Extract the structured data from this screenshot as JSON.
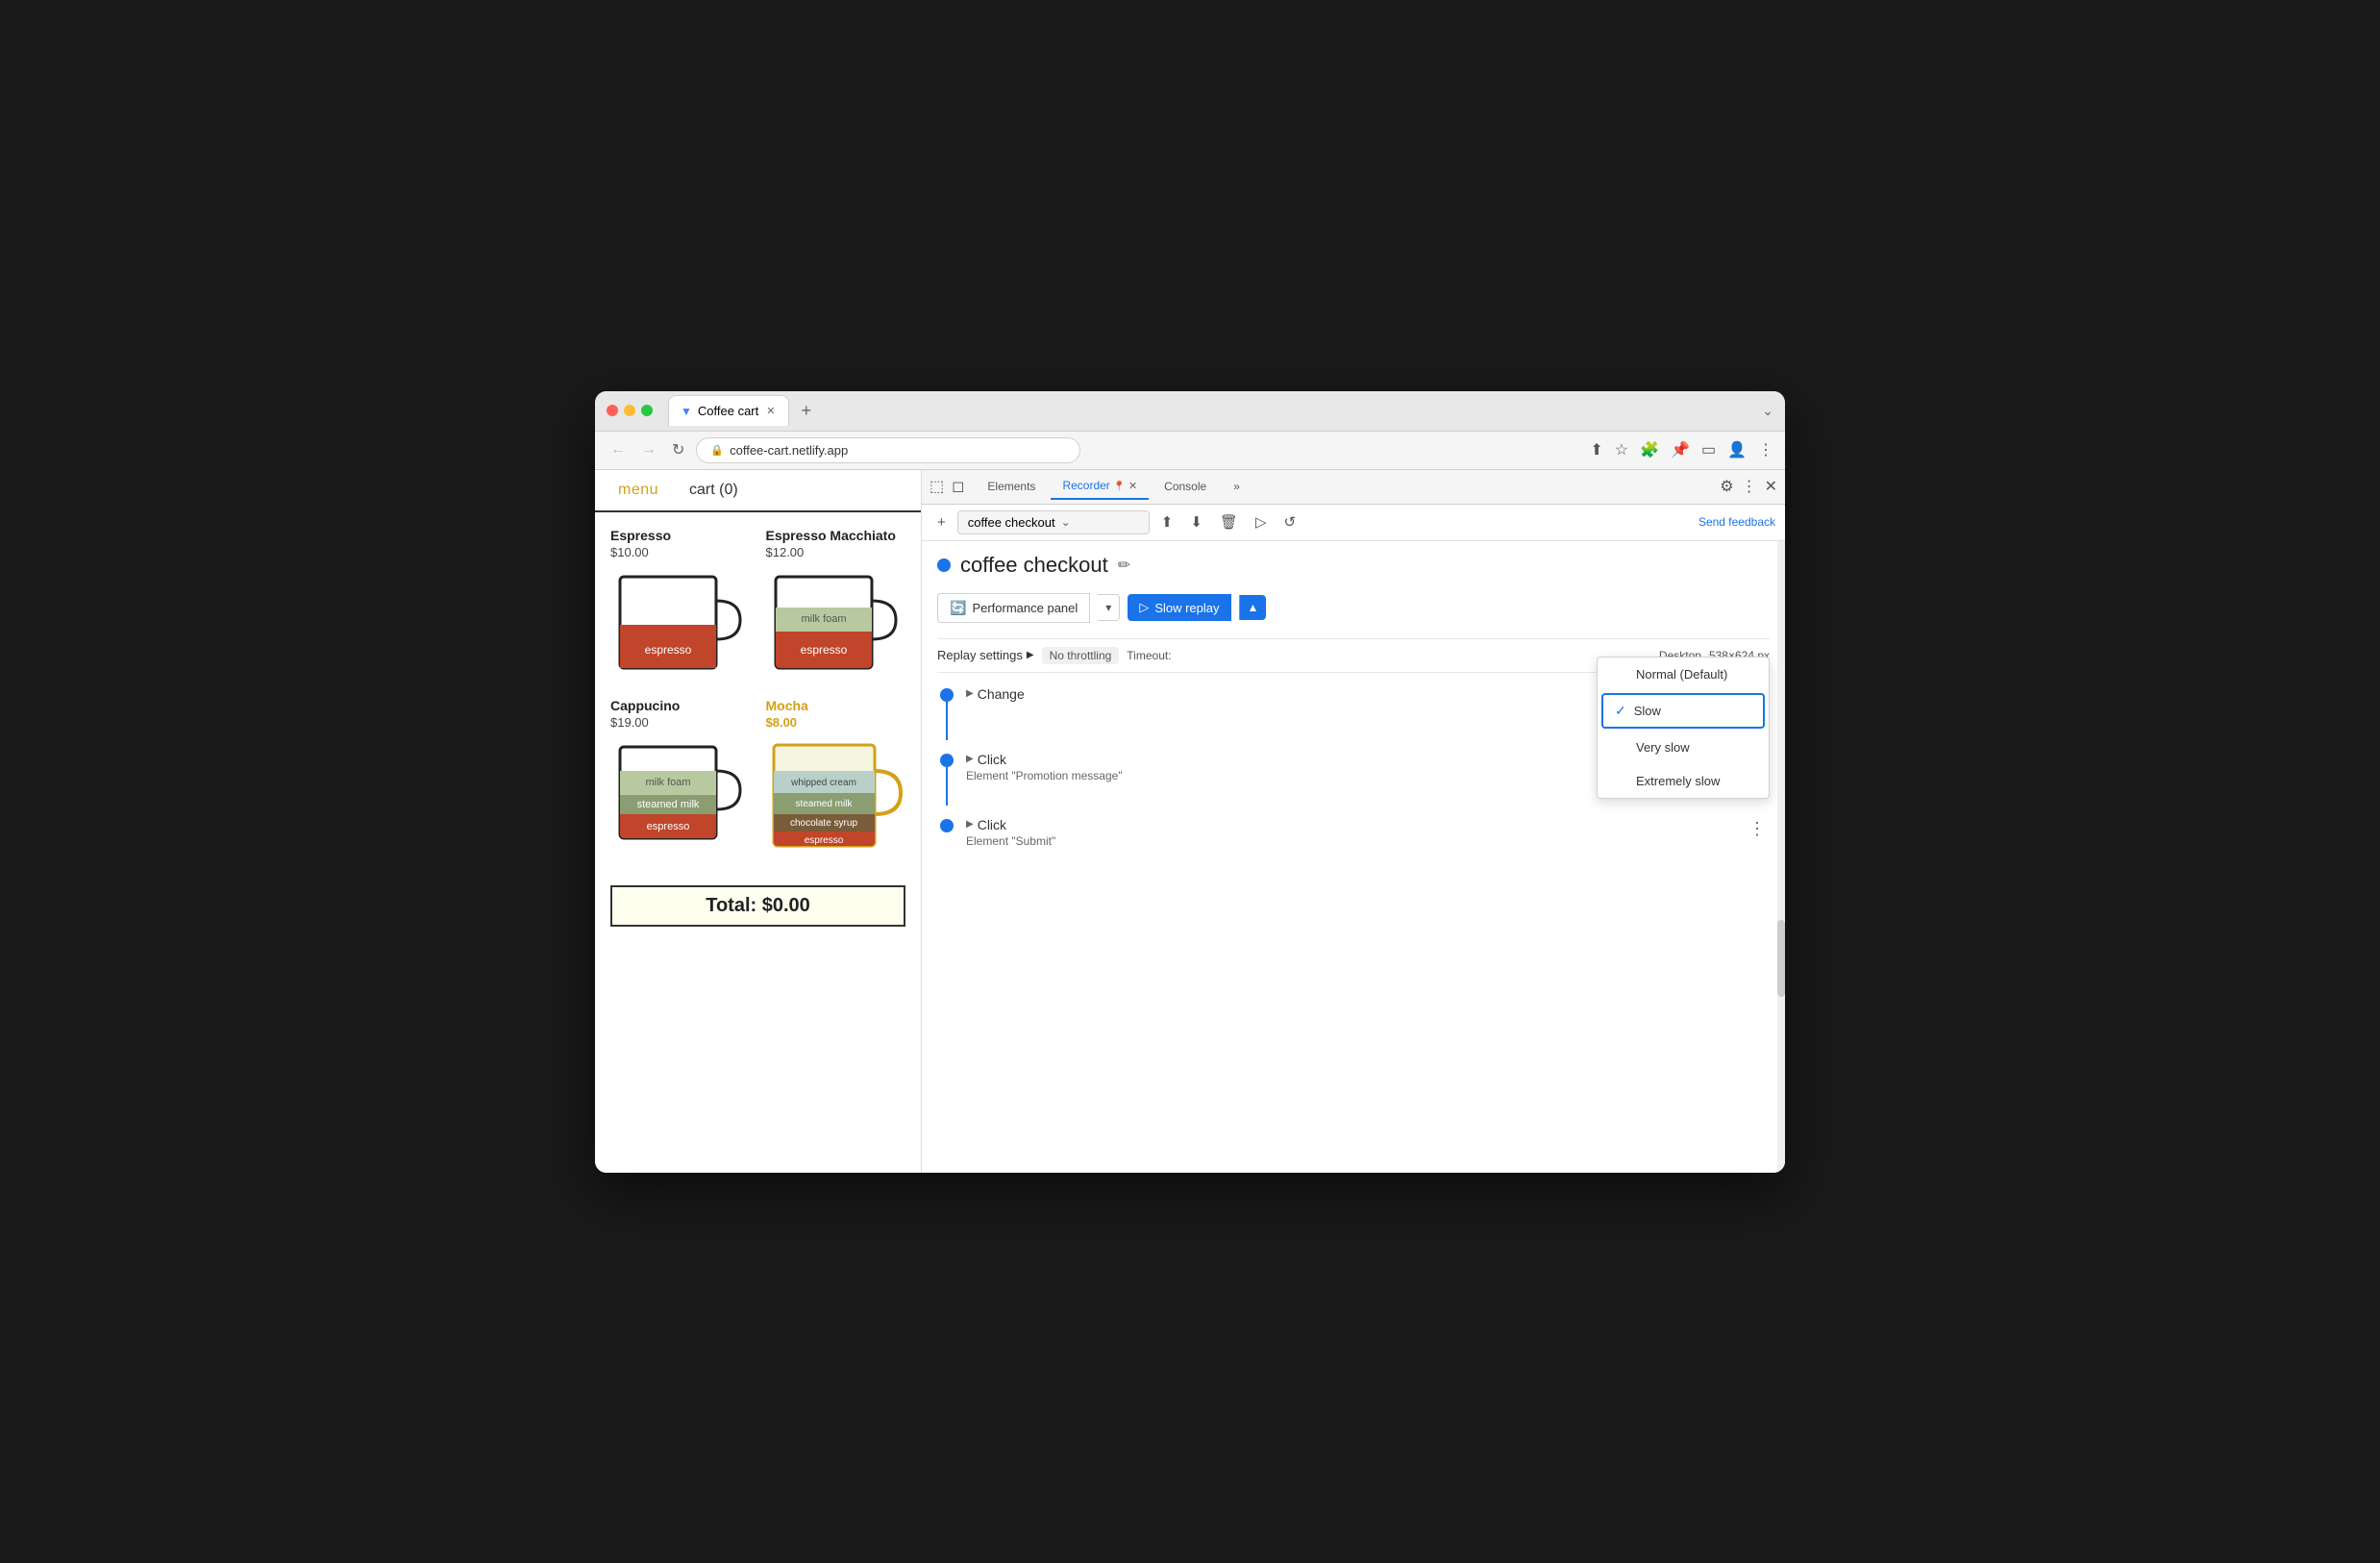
{
  "browser": {
    "title": "Coffee cart",
    "url": "coffee-cart.netlify.app",
    "tab_label": "Coffee cart",
    "new_tab_label": "+",
    "chevron_down": "⌄"
  },
  "coffee_site": {
    "nav": {
      "menu": "menu",
      "cart": "cart (0)"
    },
    "items": [
      {
        "name": "Espresso",
        "price": "$10.00",
        "highlight": false,
        "layers": [
          {
            "label": "espresso",
            "color": "#c0452a",
            "height": 40
          }
        ]
      },
      {
        "name": "Espresso Macchiato",
        "price": "$12.00",
        "highlight": false,
        "layers": [
          {
            "label": "milk foam",
            "color": "#b8c9a0",
            "height": 20
          },
          {
            "label": "espresso",
            "color": "#c0452a",
            "height": 40
          }
        ]
      },
      {
        "name": "Cappucino",
        "price": "$19.00",
        "highlight": false,
        "layers": [
          {
            "label": "milk foam",
            "color": "#b8c9a0",
            "height": 25
          },
          {
            "label": "steamed milk",
            "color": "#8a9e72",
            "height": 25
          },
          {
            "label": "espresso",
            "color": "#c0452a",
            "height": 35
          }
        ]
      },
      {
        "name": "Mocha",
        "price": "$8.00",
        "highlight": true,
        "layers": [
          {
            "label": "whipped cream",
            "color": "#b8d0c8",
            "height": 22
          },
          {
            "label": "steamed milk",
            "color": "#8a9e72",
            "height": 22
          },
          {
            "label": "chocolate syrup",
            "color": "#7a5c3a",
            "height": 22
          },
          {
            "label": "espresso",
            "color": "#c0452a",
            "height": 22
          }
        ]
      }
    ],
    "total": "Total: $0.00"
  },
  "devtools": {
    "tabs": [
      "Elements",
      "Recorder",
      "Console"
    ],
    "active_tab": "Recorder",
    "more_tabs": "»",
    "close": "✕",
    "settings_icon": "⚙",
    "more_icon": "⋮",
    "toolbar": {
      "add_icon": "+",
      "upload_icon": "⬆",
      "download_icon": "⬇",
      "delete_icon": "🗑",
      "play_icon": "▷",
      "history_icon": "↺",
      "send_feedback": "Send feedback",
      "recording_name": "coffee checkout",
      "dropdown_arrow": "⌄"
    },
    "recording": {
      "title": "coffee checkout",
      "edit_icon": "✏",
      "perf_panel": "Performance panel",
      "slow_replay": "Slow replay",
      "play_icon": "▷",
      "dropdown_arrow": "▲",
      "perf_dropdown": "▾"
    },
    "speed_dropdown": {
      "options": [
        {
          "label": "Normal (Default)",
          "selected": false
        },
        {
          "label": "Slow",
          "selected": true
        },
        {
          "label": "Very slow",
          "selected": false
        },
        {
          "label": "Extremely slow",
          "selected": false
        }
      ]
    },
    "replay_settings": {
      "label": "Replay settings",
      "arrow": "▶",
      "throttle": "No throttling",
      "timeout_label": "Timeout:",
      "env": "Desktop",
      "size": "538×624 px"
    },
    "steps": [
      {
        "title": "Change",
        "desc": "",
        "has_connector": true
      },
      {
        "title": "Click",
        "desc": "Element \"Promotion message\"",
        "has_connector": true
      },
      {
        "title": "Click",
        "desc": "Element \"Submit\"",
        "has_connector": false
      }
    ]
  }
}
